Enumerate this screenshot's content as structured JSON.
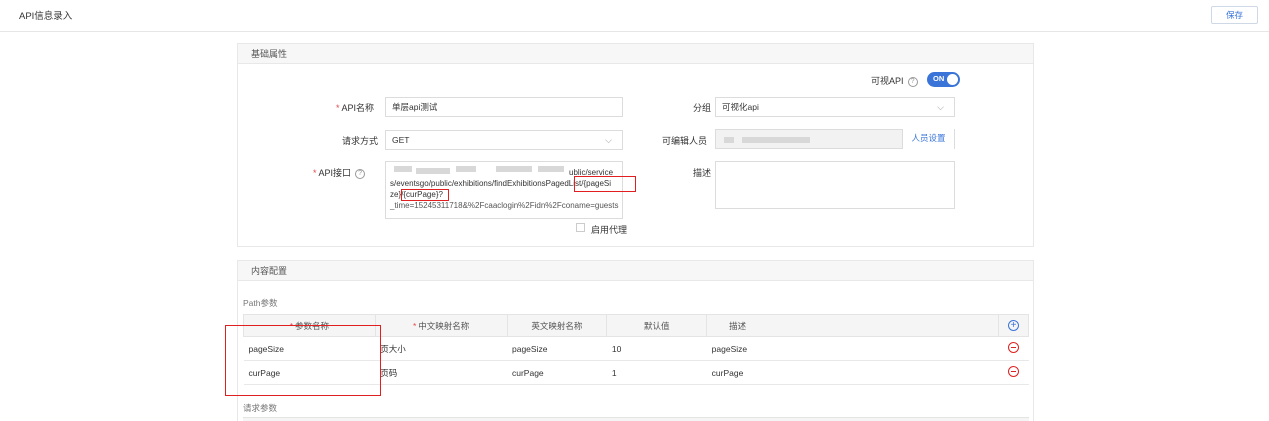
{
  "header": {
    "title": "API信息录入",
    "save_label": "保存"
  },
  "basic": {
    "section_title": "基础属性",
    "visual_api_label": "可视API",
    "visual_api_toggle": "ON",
    "api_name_label": "API名称",
    "api_name_value": "单层api测试",
    "group_label": "分组",
    "group_value": "可视化api",
    "method_label": "请求方式",
    "method_value": "GET",
    "editor_label": "可编辑人员",
    "editor_button": "人员设置",
    "api_endpoint_label": "API接口",
    "api_endpoint_line1_tail": "ublic/service",
    "api_endpoint_line2": "s/eventsgo/public/exhibitions/findExhibitionsPagedList/{pageSi",
    "api_endpoint_line3_prefix": "ze}/",
    "api_endpoint_line3_highlight": "{curPage}?",
    "api_endpoint_line4": "_time=15245311718&%2Fcaaclogin%2Fidn%2Fconame=guests",
    "desc_label": "描述",
    "proxy_label": "启用代理",
    "help_mark": "?",
    "required_mark": "*"
  },
  "content": {
    "section_title": "内容配置",
    "path_params_label": "Path参数",
    "query_params_label": "请求参数",
    "columns": [
      "参数名称",
      "中文映射名称",
      "英文映射名称",
      "默认值",
      "描述"
    ],
    "rows": [
      {
        "name": "pageSize",
        "cn": "页大小",
        "en": "pageSize",
        "default": "10",
        "desc": "pageSize"
      },
      {
        "name": "curPage",
        "cn": "页码",
        "en": "curPage",
        "default": "1",
        "desc": "curPage"
      }
    ],
    "add_icon": "plus-circle-icon",
    "remove_icon": "minus-circle-icon"
  },
  "colors": {
    "accent": "#3a74d9",
    "danger": "#e02020",
    "required": "#e5484d"
  }
}
